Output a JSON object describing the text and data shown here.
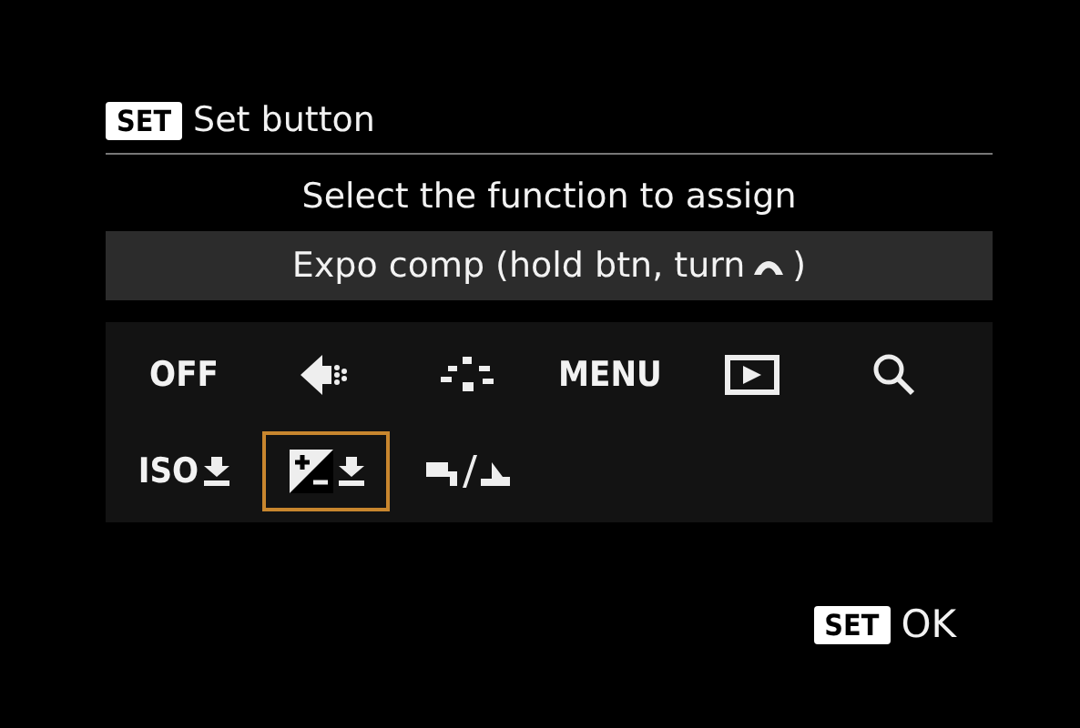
{
  "header": {
    "badge": "SET",
    "title": "Set button"
  },
  "prompt": "Select the function to assign",
  "current": {
    "label": "Expo comp (hold btn, turn",
    "close": ")"
  },
  "options": [
    {
      "kind": "text",
      "label": "OFF",
      "selected": false
    },
    {
      "kind": "focus",
      "selected": false
    },
    {
      "kind": "points",
      "selected": false
    },
    {
      "kind": "text",
      "label": "MENU",
      "selected": false
    },
    {
      "kind": "play",
      "selected": false
    },
    {
      "kind": "search",
      "selected": false
    },
    {
      "kind": "iso",
      "label": "ISO",
      "selected": false
    },
    {
      "kind": "expo",
      "selected": true
    },
    {
      "kind": "swap",
      "selected": false
    }
  ],
  "footer": {
    "badge": "SET",
    "label": "OK"
  }
}
